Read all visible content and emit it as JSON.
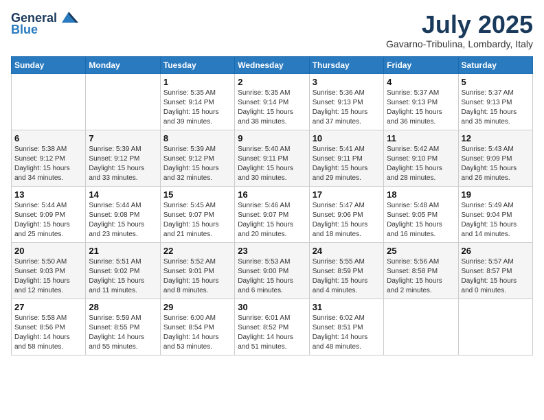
{
  "logo": {
    "general": "General",
    "blue": "Blue"
  },
  "title": "July 2025",
  "location": "Gavarno-Tribulina, Lombardy, Italy",
  "weekdays": [
    "Sunday",
    "Monday",
    "Tuesday",
    "Wednesday",
    "Thursday",
    "Friday",
    "Saturday"
  ],
  "weeks": [
    [
      {
        "day": "",
        "info": ""
      },
      {
        "day": "",
        "info": ""
      },
      {
        "day": "1",
        "info": "Sunrise: 5:35 AM\nSunset: 9:14 PM\nDaylight: 15 hours\nand 39 minutes."
      },
      {
        "day": "2",
        "info": "Sunrise: 5:35 AM\nSunset: 9:14 PM\nDaylight: 15 hours\nand 38 minutes."
      },
      {
        "day": "3",
        "info": "Sunrise: 5:36 AM\nSunset: 9:13 PM\nDaylight: 15 hours\nand 37 minutes."
      },
      {
        "day": "4",
        "info": "Sunrise: 5:37 AM\nSunset: 9:13 PM\nDaylight: 15 hours\nand 36 minutes."
      },
      {
        "day": "5",
        "info": "Sunrise: 5:37 AM\nSunset: 9:13 PM\nDaylight: 15 hours\nand 35 minutes."
      }
    ],
    [
      {
        "day": "6",
        "info": "Sunrise: 5:38 AM\nSunset: 9:12 PM\nDaylight: 15 hours\nand 34 minutes."
      },
      {
        "day": "7",
        "info": "Sunrise: 5:39 AM\nSunset: 9:12 PM\nDaylight: 15 hours\nand 33 minutes."
      },
      {
        "day": "8",
        "info": "Sunrise: 5:39 AM\nSunset: 9:12 PM\nDaylight: 15 hours\nand 32 minutes."
      },
      {
        "day": "9",
        "info": "Sunrise: 5:40 AM\nSunset: 9:11 PM\nDaylight: 15 hours\nand 30 minutes."
      },
      {
        "day": "10",
        "info": "Sunrise: 5:41 AM\nSunset: 9:11 PM\nDaylight: 15 hours\nand 29 minutes."
      },
      {
        "day": "11",
        "info": "Sunrise: 5:42 AM\nSunset: 9:10 PM\nDaylight: 15 hours\nand 28 minutes."
      },
      {
        "day": "12",
        "info": "Sunrise: 5:43 AM\nSunset: 9:09 PM\nDaylight: 15 hours\nand 26 minutes."
      }
    ],
    [
      {
        "day": "13",
        "info": "Sunrise: 5:44 AM\nSunset: 9:09 PM\nDaylight: 15 hours\nand 25 minutes."
      },
      {
        "day": "14",
        "info": "Sunrise: 5:44 AM\nSunset: 9:08 PM\nDaylight: 15 hours\nand 23 minutes."
      },
      {
        "day": "15",
        "info": "Sunrise: 5:45 AM\nSunset: 9:07 PM\nDaylight: 15 hours\nand 21 minutes."
      },
      {
        "day": "16",
        "info": "Sunrise: 5:46 AM\nSunset: 9:07 PM\nDaylight: 15 hours\nand 20 minutes."
      },
      {
        "day": "17",
        "info": "Sunrise: 5:47 AM\nSunset: 9:06 PM\nDaylight: 15 hours\nand 18 minutes."
      },
      {
        "day": "18",
        "info": "Sunrise: 5:48 AM\nSunset: 9:05 PM\nDaylight: 15 hours\nand 16 minutes."
      },
      {
        "day": "19",
        "info": "Sunrise: 5:49 AM\nSunset: 9:04 PM\nDaylight: 15 hours\nand 14 minutes."
      }
    ],
    [
      {
        "day": "20",
        "info": "Sunrise: 5:50 AM\nSunset: 9:03 PM\nDaylight: 15 hours\nand 12 minutes."
      },
      {
        "day": "21",
        "info": "Sunrise: 5:51 AM\nSunset: 9:02 PM\nDaylight: 15 hours\nand 11 minutes."
      },
      {
        "day": "22",
        "info": "Sunrise: 5:52 AM\nSunset: 9:01 PM\nDaylight: 15 hours\nand 8 minutes."
      },
      {
        "day": "23",
        "info": "Sunrise: 5:53 AM\nSunset: 9:00 PM\nDaylight: 15 hours\nand 6 minutes."
      },
      {
        "day": "24",
        "info": "Sunrise: 5:55 AM\nSunset: 8:59 PM\nDaylight: 15 hours\nand 4 minutes."
      },
      {
        "day": "25",
        "info": "Sunrise: 5:56 AM\nSunset: 8:58 PM\nDaylight: 15 hours\nand 2 minutes."
      },
      {
        "day": "26",
        "info": "Sunrise: 5:57 AM\nSunset: 8:57 PM\nDaylight: 15 hours\nand 0 minutes."
      }
    ],
    [
      {
        "day": "27",
        "info": "Sunrise: 5:58 AM\nSunset: 8:56 PM\nDaylight: 14 hours\nand 58 minutes."
      },
      {
        "day": "28",
        "info": "Sunrise: 5:59 AM\nSunset: 8:55 PM\nDaylight: 14 hours\nand 55 minutes."
      },
      {
        "day": "29",
        "info": "Sunrise: 6:00 AM\nSunset: 8:54 PM\nDaylight: 14 hours\nand 53 minutes."
      },
      {
        "day": "30",
        "info": "Sunrise: 6:01 AM\nSunset: 8:52 PM\nDaylight: 14 hours\nand 51 minutes."
      },
      {
        "day": "31",
        "info": "Sunrise: 6:02 AM\nSunset: 8:51 PM\nDaylight: 14 hours\nand 48 minutes."
      },
      {
        "day": "",
        "info": ""
      },
      {
        "day": "",
        "info": ""
      }
    ]
  ]
}
